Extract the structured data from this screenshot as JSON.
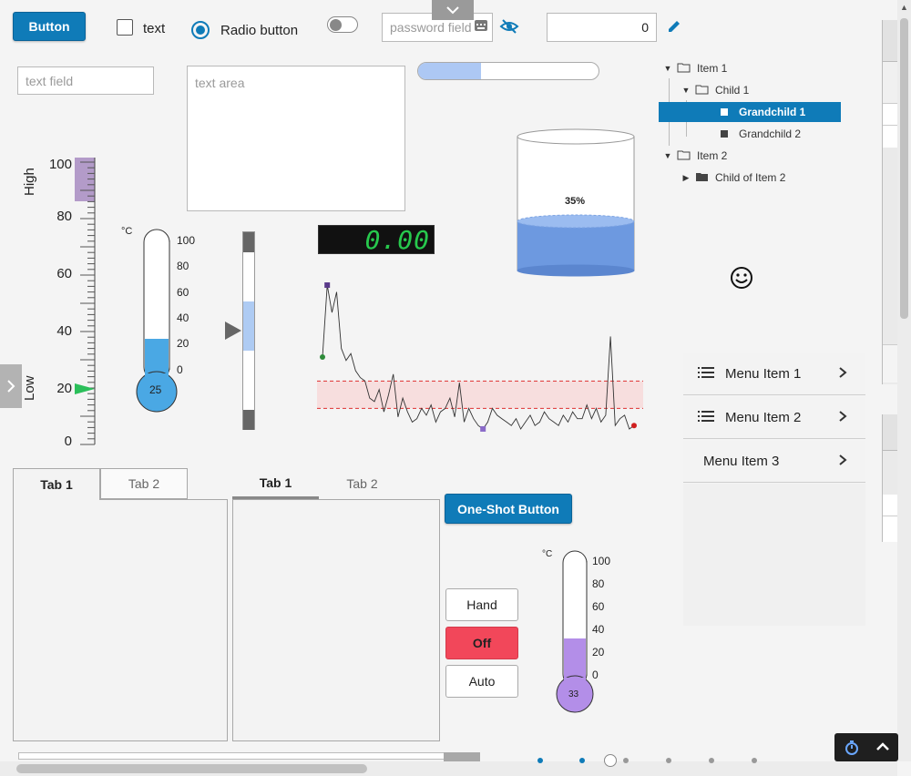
{
  "controls": {
    "button_label": "Button",
    "checkbox_label": "text",
    "radio_label": "Radio button",
    "password_placeholder": "password field",
    "numeric_value": "0",
    "textfield_placeholder": "text field",
    "textarea_placeholder": "text area",
    "progress_fraction": 0.35
  },
  "gauge": {
    "high_label": "High",
    "low_label": "Low",
    "ticks": [
      "100",
      "80",
      "60",
      "40",
      "20",
      "0"
    ],
    "pointer_value": 20
  },
  "thermometer1": {
    "unit": "°C",
    "ticks": [
      "100",
      "80",
      "60",
      "40",
      "20",
      "0"
    ],
    "value_text": "25",
    "fill_color": "#4aa8e4"
  },
  "thermometer2": {
    "unit": "°C",
    "ticks": [
      "100",
      "80",
      "60",
      "40",
      "20",
      "0"
    ],
    "value_text": "33",
    "fill_color": "#b38ee8"
  },
  "digital_display": {
    "value": "0.00",
    "color": "#27c94d"
  },
  "tank": {
    "percent_label": "35%",
    "fill_color": "#6d99e0"
  },
  "tree": {
    "items": [
      {
        "label": "Item 1",
        "level": 0,
        "expanded": true,
        "icon": "folder-open-icon"
      },
      {
        "label": "Child 1",
        "level": 1,
        "expanded": true,
        "icon": "folder-open-icon"
      },
      {
        "label": "Grandchild 1",
        "level": 2,
        "selected": true,
        "icon": "leaf-square-icon"
      },
      {
        "label": "Grandchild 2",
        "level": 2,
        "icon": "leaf-square-icon"
      },
      {
        "label": "Item 2",
        "level": 0,
        "expanded": true,
        "icon": "folder-open-icon"
      },
      {
        "label": "Child of Item 2",
        "level": 1,
        "expanded": false,
        "icon": "folder-closed-icon"
      }
    ]
  },
  "menu": {
    "items": [
      "Menu Item 1",
      "Menu Item 2",
      "Menu Item 3"
    ]
  },
  "tabs_left": {
    "tab1": "Tab 1",
    "tab2": "Tab 2"
  },
  "tabs_right": {
    "tab1": "Tab 1",
    "tab2": "Tab 2"
  },
  "one_shot_label": "One-Shot Button",
  "hand_off_auto": {
    "hand": "Hand",
    "off": "Off",
    "auto": "Auto",
    "active": "Off",
    "active_color": "#f2475a"
  },
  "sparkline": {
    "values": [
      50,
      92,
      76,
      88,
      55,
      48,
      52,
      42,
      38,
      36,
      26,
      24,
      31,
      18,
      28,
      40,
      15,
      26,
      18,
      12,
      14,
      20,
      16,
      22,
      12,
      18,
      20,
      26,
      15,
      35,
      12,
      20,
      14,
      10,
      8,
      12,
      20,
      16,
      14,
      12,
      10,
      14,
      8,
      12,
      16,
      10,
      12,
      18,
      14,
      12,
      10,
      16,
      12,
      18,
      14,
      14,
      22,
      14,
      20,
      12,
      16,
      62,
      10,
      14,
      16,
      8,
      10
    ],
    "band_low": 20,
    "band_high": 36,
    "min_value": 0,
    "max_value": 100
  }
}
